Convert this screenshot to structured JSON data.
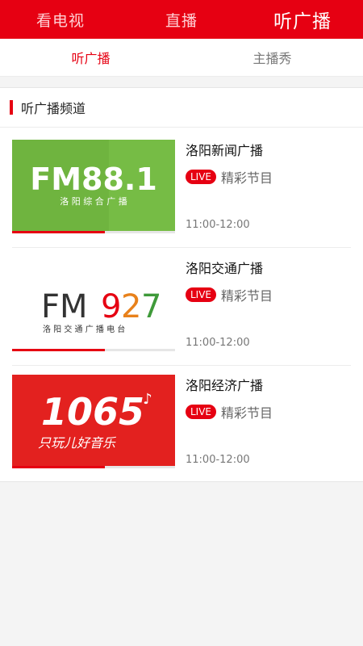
{
  "top_tabs": [
    {
      "label": "看电视"
    },
    {
      "label": "直播"
    },
    {
      "label": "听广播"
    }
  ],
  "sub_tabs": [
    {
      "label": "听广播"
    },
    {
      "label": "主播秀"
    }
  ],
  "section": {
    "title": "听广播频道"
  },
  "stations": [
    {
      "name": "洛阳新闻广播",
      "live": "LIVE",
      "program": "精彩节目",
      "time": "11:00-12:00",
      "logo_main": "FM88.1",
      "logo_sub": "洛 阳 综 合 广 播",
      "logo_bg": "#6fb43f",
      "progress": 0.57
    },
    {
      "name": "洛阳交通广播",
      "live": "LIVE",
      "program": "精彩节目",
      "time": "11:00-12:00",
      "logo_main_fm": "FM",
      "logo_digit_9": "9",
      "logo_digit_2": "2",
      "logo_digit_7": "7",
      "logo_sub": "洛 阳 交 通 广 播 电 台",
      "logo_bg": "#ffffff",
      "progress": 0.57
    },
    {
      "name": "洛阳经济广播",
      "live": "LIVE",
      "program": "精彩节目",
      "time": "11:00-12:00",
      "logo_main": "1065",
      "logo_sub": "只玩儿好音乐",
      "logo_bg": "#e3211f",
      "progress": 0.57
    }
  ],
  "colors": {
    "accent": "#e60012",
    "green": "#6fb43f",
    "fm927_orange": "#e8811b",
    "fm927_green": "#3f9a3a"
  }
}
